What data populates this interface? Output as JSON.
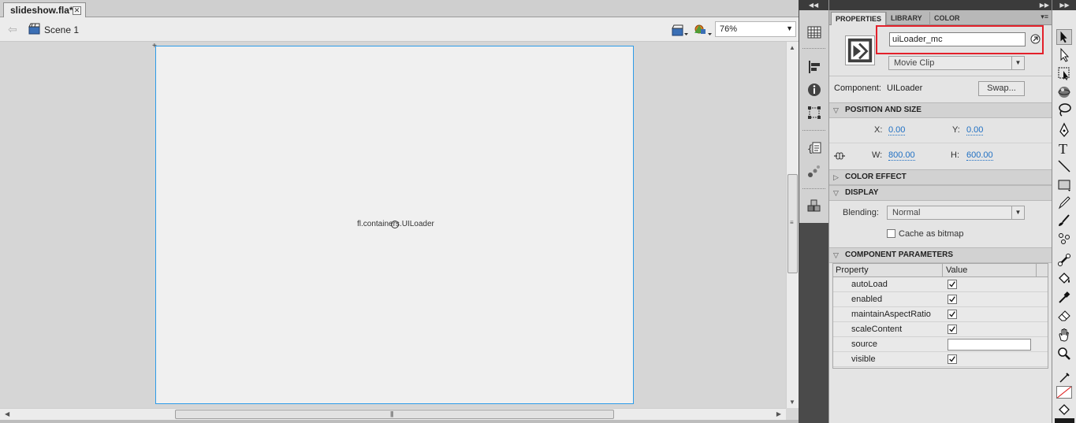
{
  "document": {
    "tab_title": "slideshow.fla*",
    "close_icon": "close-icon",
    "back_icon": "back-arrow-icon",
    "scene_label": "Scene 1",
    "zoom": "76%",
    "stage_label": "fl.containers.UILoader"
  },
  "panel_tabs": [
    "PROPERTIES",
    "LIBRARY",
    "COLOR"
  ],
  "properties": {
    "instance_name": "uiLoader_mc",
    "symbol_type": "Movie Clip",
    "component_label": "Component:",
    "component_name": "UILoader",
    "swap_label": "Swap...",
    "highlight_color": "#e3202a",
    "position_size": {
      "title": "POSITION AND SIZE",
      "x_label": "X:",
      "x_value": "0.00",
      "y_label": "Y:",
      "y_value": "0.00",
      "w_label": "W:",
      "w_value": "800.00",
      "h_label": "H:",
      "h_value": "600.00"
    },
    "color_effect_title": "COLOR EFFECT",
    "display": {
      "title": "DISPLAY",
      "blending_label": "Blending:",
      "blending_value": "Normal",
      "cache_label": "Cache as bitmap",
      "cache_checked": false
    },
    "component_parameters": {
      "title": "COMPONENT PARAMETERS",
      "col_property": "Property",
      "col_value": "Value",
      "rows": [
        {
          "name": "autoLoad",
          "type": "checkbox",
          "checked": true
        },
        {
          "name": "enabled",
          "type": "checkbox",
          "checked": true
        },
        {
          "name": "maintainAspectRatio",
          "type": "checkbox",
          "checked": true
        },
        {
          "name": "scaleContent",
          "type": "checkbox",
          "checked": true
        },
        {
          "name": "source",
          "type": "text",
          "value": ""
        },
        {
          "name": "visible",
          "type": "checkbox",
          "checked": true
        }
      ]
    }
  },
  "icon_panel": [
    "grid-icon",
    "align-icon",
    "info-icon",
    "transform-icon",
    "code-snippets-icon",
    "motion-presets-icon",
    "components-icon"
  ],
  "tools": [
    "selection-tool-icon",
    "subselection-tool-icon",
    "free-transform-tool-icon",
    "3d-rotation-tool-icon",
    "lasso-tool-icon",
    "pen-tool-icon",
    "text-tool-icon",
    "line-tool-icon",
    "rectangle-tool-icon",
    "pencil-tool-icon",
    "brush-tool-icon",
    "deco-tool-icon",
    "bone-tool-icon",
    "paint-bucket-tool-icon",
    "eyedropper-tool-icon",
    "eraser-tool-icon",
    "hand-tool-icon",
    "zoom-tool-icon",
    "stroke-color-icon",
    "fill-color-icon"
  ]
}
